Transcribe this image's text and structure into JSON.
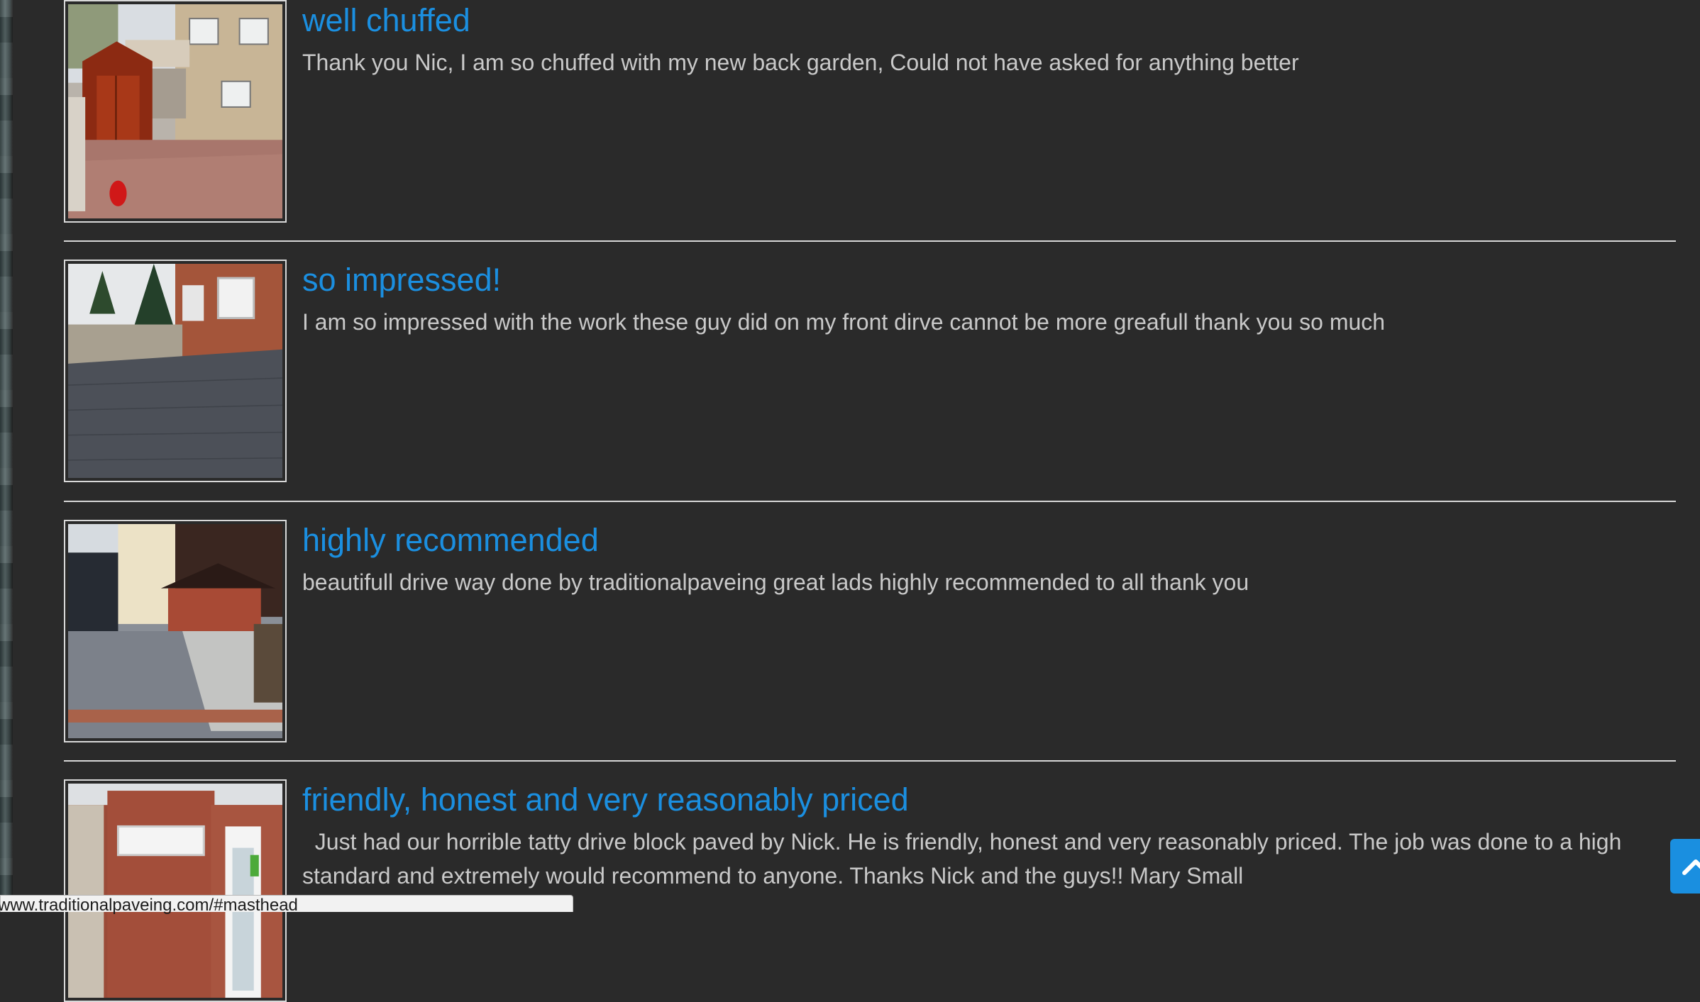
{
  "reviews": [
    {
      "title": "well chuffed",
      "text": "Thank you Nic, I am so chuffed with my new back garden, Could not have asked for anything better"
    },
    {
      "title": "so impressed!",
      "text": "I am so impressed with the work these guy did on my front dirve cannot be more greafull thank you so much"
    },
    {
      "title": "highly recommended",
      "text": "beautifull drive way done by traditionalpaveing great lads highly recommended to all thank you"
    },
    {
      "title": "friendly, honest and very reasonably priced",
      "text": "  Just had our horrible tatty drive block paved by Nick. He is friendly, honest and very reasonably priced. The job was done to a high standard and extremely would recommend to anyone. Thanks Nick and the guys!! Mary Small"
    }
  ],
  "status_bar": {
    "url": "www.traditionalpaveing.com/#masthead"
  },
  "back_to_top": {
    "icon": "chevron-up-icon"
  },
  "colors": {
    "accent": "#1b8fe0",
    "background": "#2a2a2a",
    "text": "#c9c9c9",
    "divider": "#d8d8d8"
  }
}
